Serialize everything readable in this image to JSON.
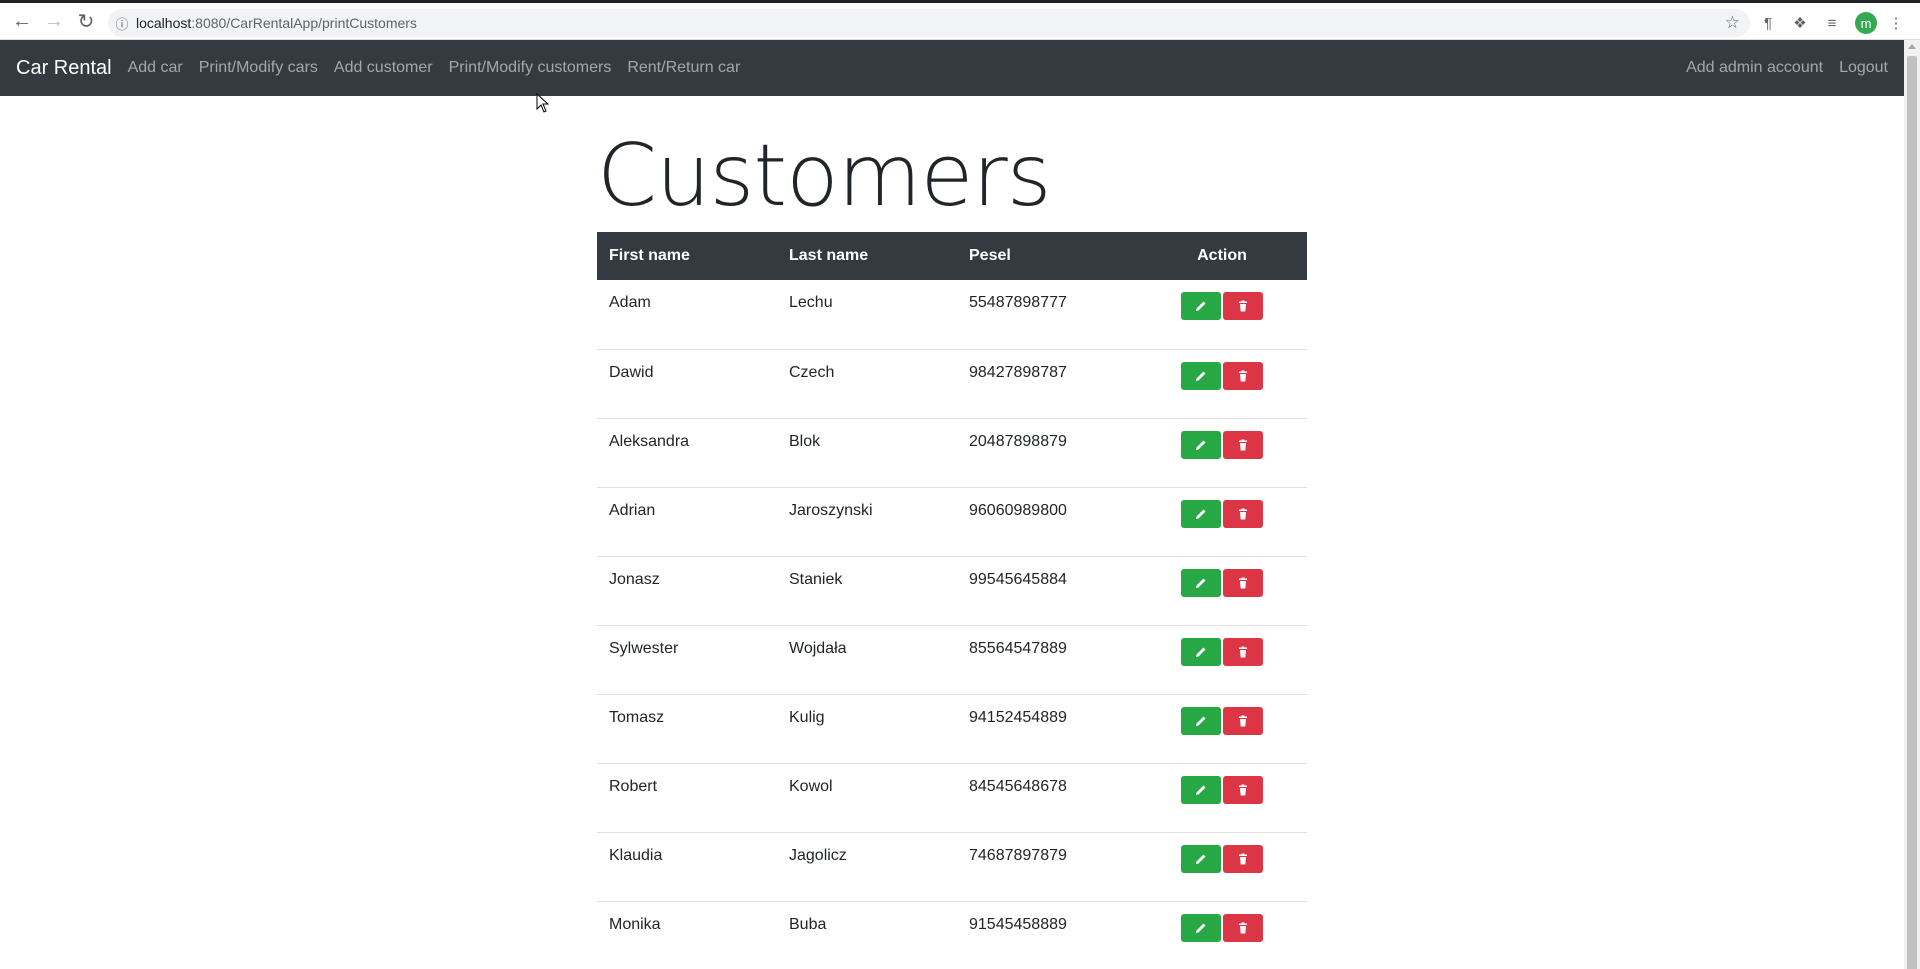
{
  "browser": {
    "url_host": "localhost",
    "url_path": ":8080/CarRentalApp/printCustomers",
    "avatar_letter": "m"
  },
  "navbar": {
    "brand": "Car Rental",
    "links": [
      "Add car",
      "Print/Modify cars",
      "Add customer",
      "Print/Modify customers",
      "Rent/Return car"
    ],
    "right_links": [
      "Add admin account",
      "Logout"
    ]
  },
  "page": {
    "title": "Customers",
    "columns": [
      "First name",
      "Last name",
      "Pesel",
      "Action"
    ],
    "rows": [
      {
        "first": "Adam",
        "last": "Lechu",
        "pesel": "55487898777"
      },
      {
        "first": "Dawid",
        "last": "Czech",
        "pesel": "98427898787"
      },
      {
        "first": "Aleksandra",
        "last": "Blok",
        "pesel": "20487898879"
      },
      {
        "first": "Adrian",
        "last": "Jaroszynski",
        "pesel": "96060989800"
      },
      {
        "first": "Jonasz",
        "last": "Staniek",
        "pesel": "99545645884"
      },
      {
        "first": "Sylwester",
        "last": "Wojdała",
        "pesel": "85564547889"
      },
      {
        "first": "Tomasz",
        "last": "Kulig",
        "pesel": "94152454889"
      },
      {
        "first": "Robert",
        "last": "Kowol",
        "pesel": "84545648678"
      },
      {
        "first": "Klaudia",
        "last": "Jagolicz",
        "pesel": "74687897879"
      },
      {
        "first": "Monika",
        "last": "Buba",
        "pesel": "91545458889"
      }
    ]
  },
  "colors": {
    "navbar_bg": "#343a40",
    "edit_button": "#28a745",
    "delete_button": "#dc3545"
  }
}
